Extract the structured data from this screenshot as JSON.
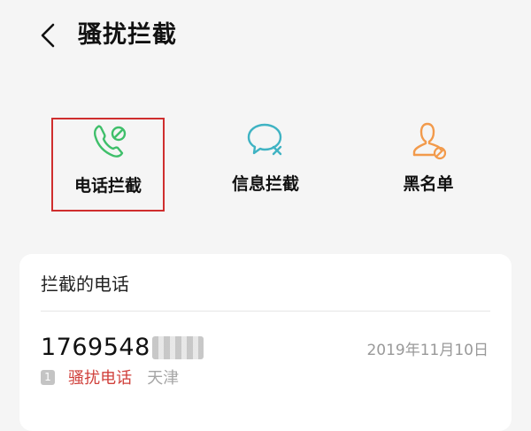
{
  "header": {
    "title": "骚扰拦截",
    "back_icon": "chevron-left-icon"
  },
  "features": [
    {
      "label": "电话拦截",
      "icon": "phone-block-icon",
      "color": "#3fbf6a",
      "selected": true
    },
    {
      "label": "信息拦截",
      "icon": "message-block-icon",
      "color": "#3fb3c3",
      "selected": false
    },
    {
      "label": "黑名单",
      "icon": "person-block-icon",
      "color": "#f29a4b",
      "selected": false
    }
  ],
  "blocked_calls": {
    "title": "拦截的电话",
    "items": [
      {
        "number": "1769548",
        "date": "2019年11月10日",
        "sim": "1",
        "tag": "骚扰电话",
        "location": "天津"
      }
    ]
  },
  "colors": {
    "selected_border": "#cf2e2e",
    "tag_red": "#d0403b",
    "date_gray": "#999999",
    "background": "#f5f5f5",
    "card": "#ffffff"
  }
}
